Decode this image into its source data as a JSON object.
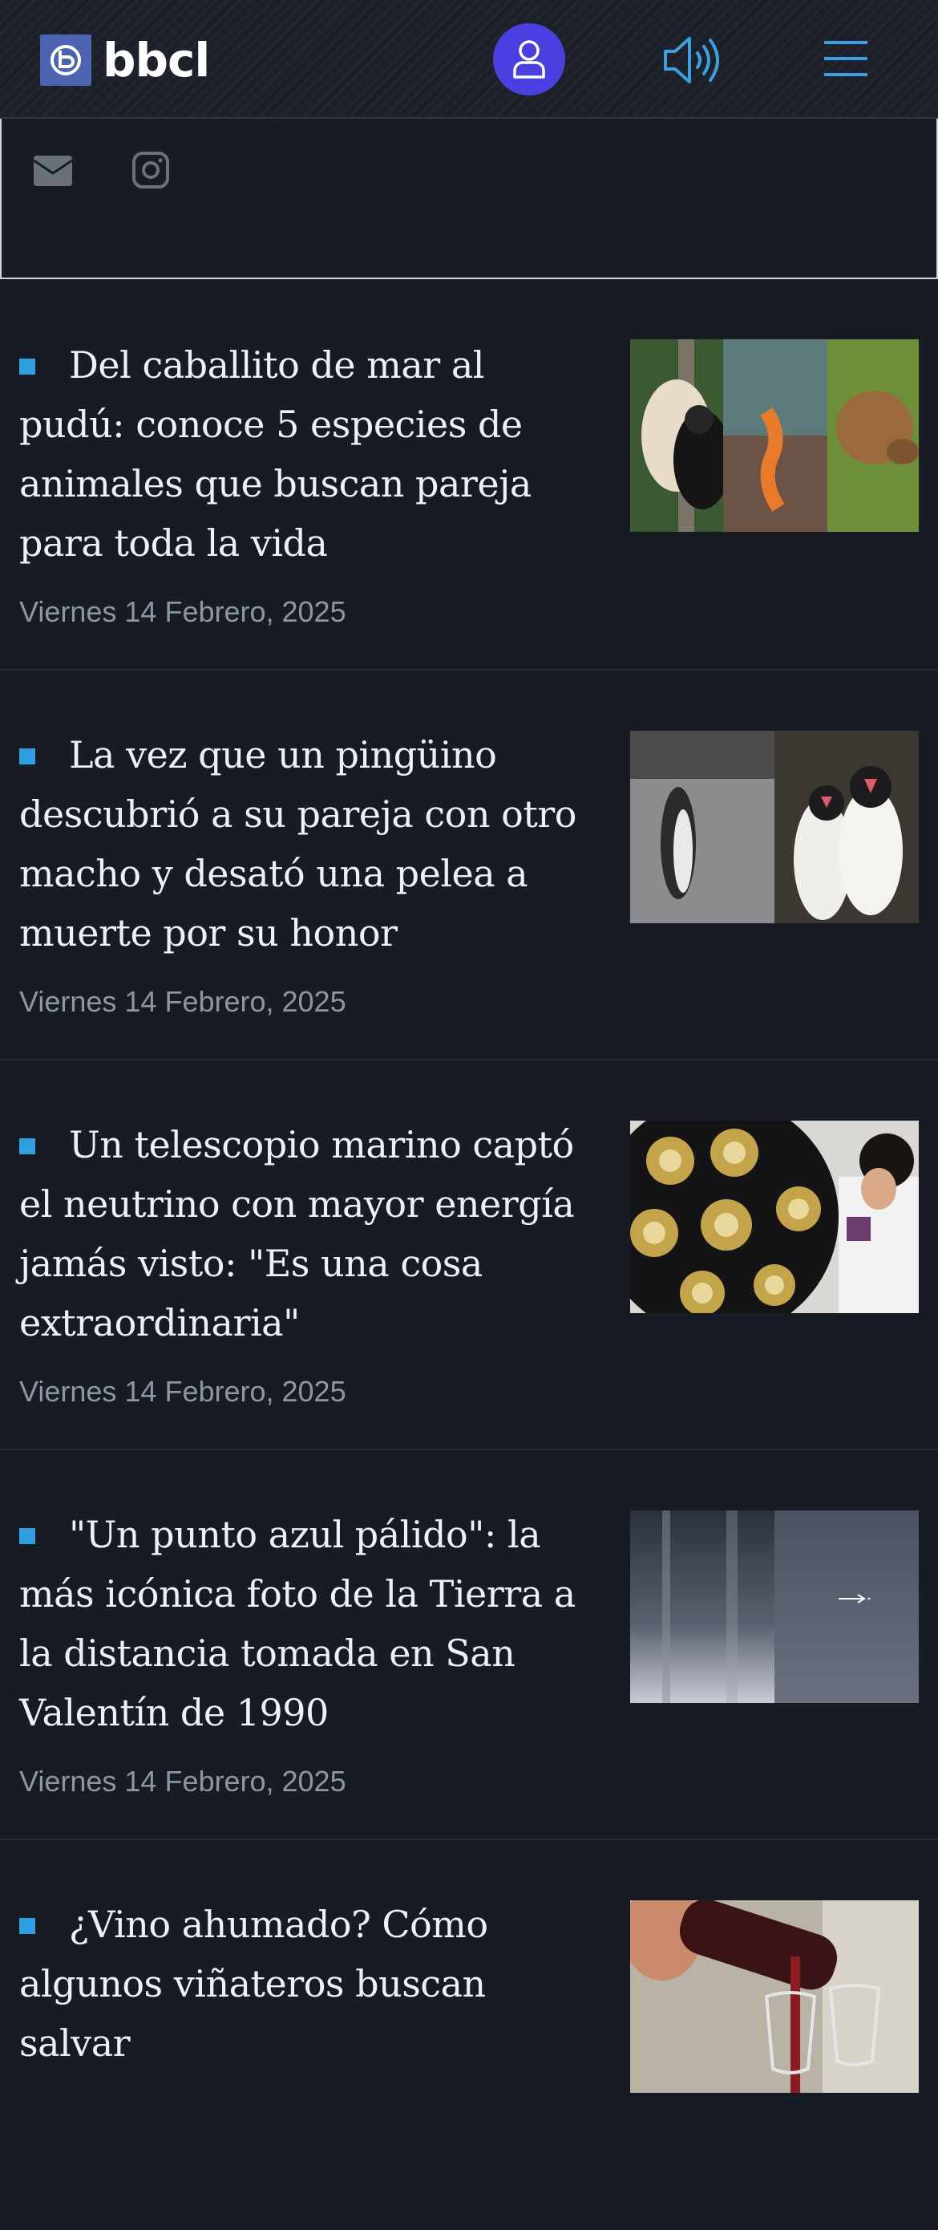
{
  "header": {
    "logo_text": "bbcl",
    "icons": [
      "logo-mark",
      "user-icon",
      "speaker-icon",
      "hamburger-menu-icon"
    ]
  },
  "social": {
    "icons": [
      "email-icon",
      "instagram-icon"
    ]
  },
  "articles": [
    {
      "title": "Del caballito de mar al pudú: conoce 5 especies de animales que buscan pareja para toda la vida",
      "date": "Viernes 14 Febrero, 2025"
    },
    {
      "title": "La vez que un pingüino descubrió a su pareja con otro macho y desató una pelea a muerte por su honor",
      "date": "Viernes 14 Febrero, 2025"
    },
    {
      "title": "Un telescopio marino captó el neutrino con mayor energía jamás visto: \"Es una cosa extraordinaria\"",
      "date": "Viernes 14 Febrero, 2025"
    },
    {
      "title": "\"Un punto azul pálido\": la más icónica foto de la Tierra a la distancia tomada en San Valentín de 1990",
      "date": "Viernes 14 Febrero, 2025"
    },
    {
      "title": "¿Vino ahumado? Cómo algunos viñateros buscan salvar",
      "date": ""
    }
  ],
  "colors": {
    "background": "#171c24",
    "accent_blue": "#2f9fe0",
    "user_button": "#4a3fe0",
    "date_gray": "#8d96a2"
  }
}
